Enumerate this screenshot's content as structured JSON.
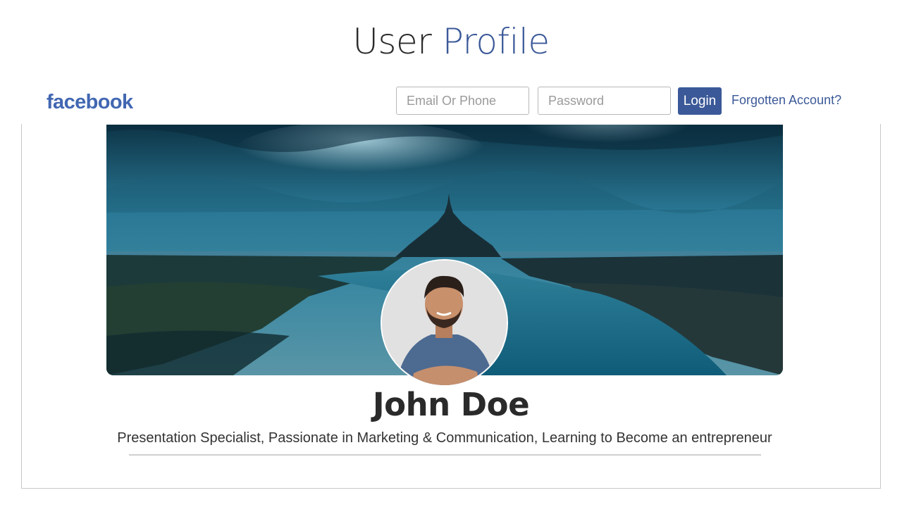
{
  "page": {
    "title_prefix": "User",
    "title_accent": "Profile"
  },
  "header": {
    "brand": "facebook",
    "email_placeholder": "Email Or Phone",
    "password_placeholder": "Password",
    "login_label": "Login",
    "forgot_label": "Forgotten Account?"
  },
  "profile": {
    "name": "John Doe",
    "bio": "Presentation Specialist, Passionate in Marketing & Communication, Learning to Become an entrepreneur"
  },
  "colors": {
    "accent": "#3b5998",
    "brand": "#4267b2"
  }
}
